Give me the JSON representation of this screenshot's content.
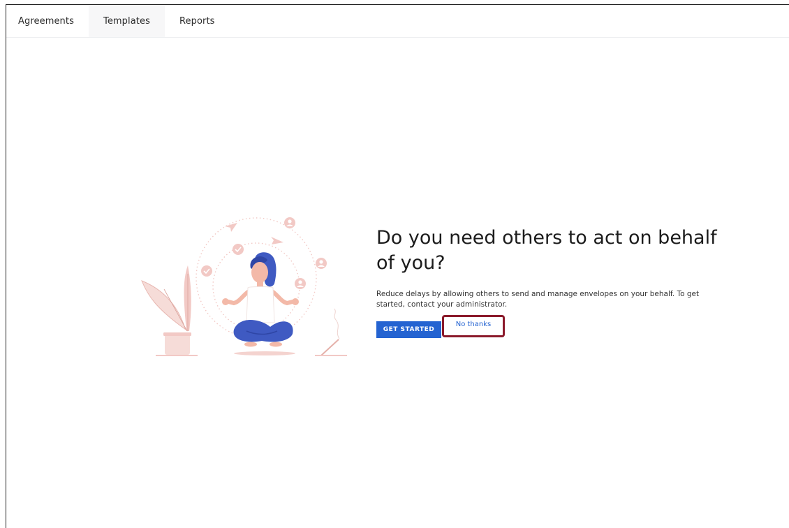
{
  "nav": {
    "tabs": [
      {
        "label": "Agreements"
      },
      {
        "label": "Templates"
      },
      {
        "label": "Reports"
      }
    ]
  },
  "prompt": {
    "title": "Do you need others to act on behalf of you?",
    "description": "Reduce delays by allowing others to send and manage envelopes on your behalf. To get started, contact your administrator.",
    "primary_label": "GET STARTED",
    "secondary_label": "No thanks"
  },
  "colors": {
    "primary": "#2463d1",
    "highlight_border": "#8b1a2b",
    "illustration_pink": "#f2c9c5",
    "illustration_blue": "#3f5ac2"
  },
  "illustration": {
    "icons": [
      "paper-plane-icon",
      "check-circle-icon",
      "user-circle-icon",
      "plant-icon",
      "incense-icon"
    ]
  }
}
